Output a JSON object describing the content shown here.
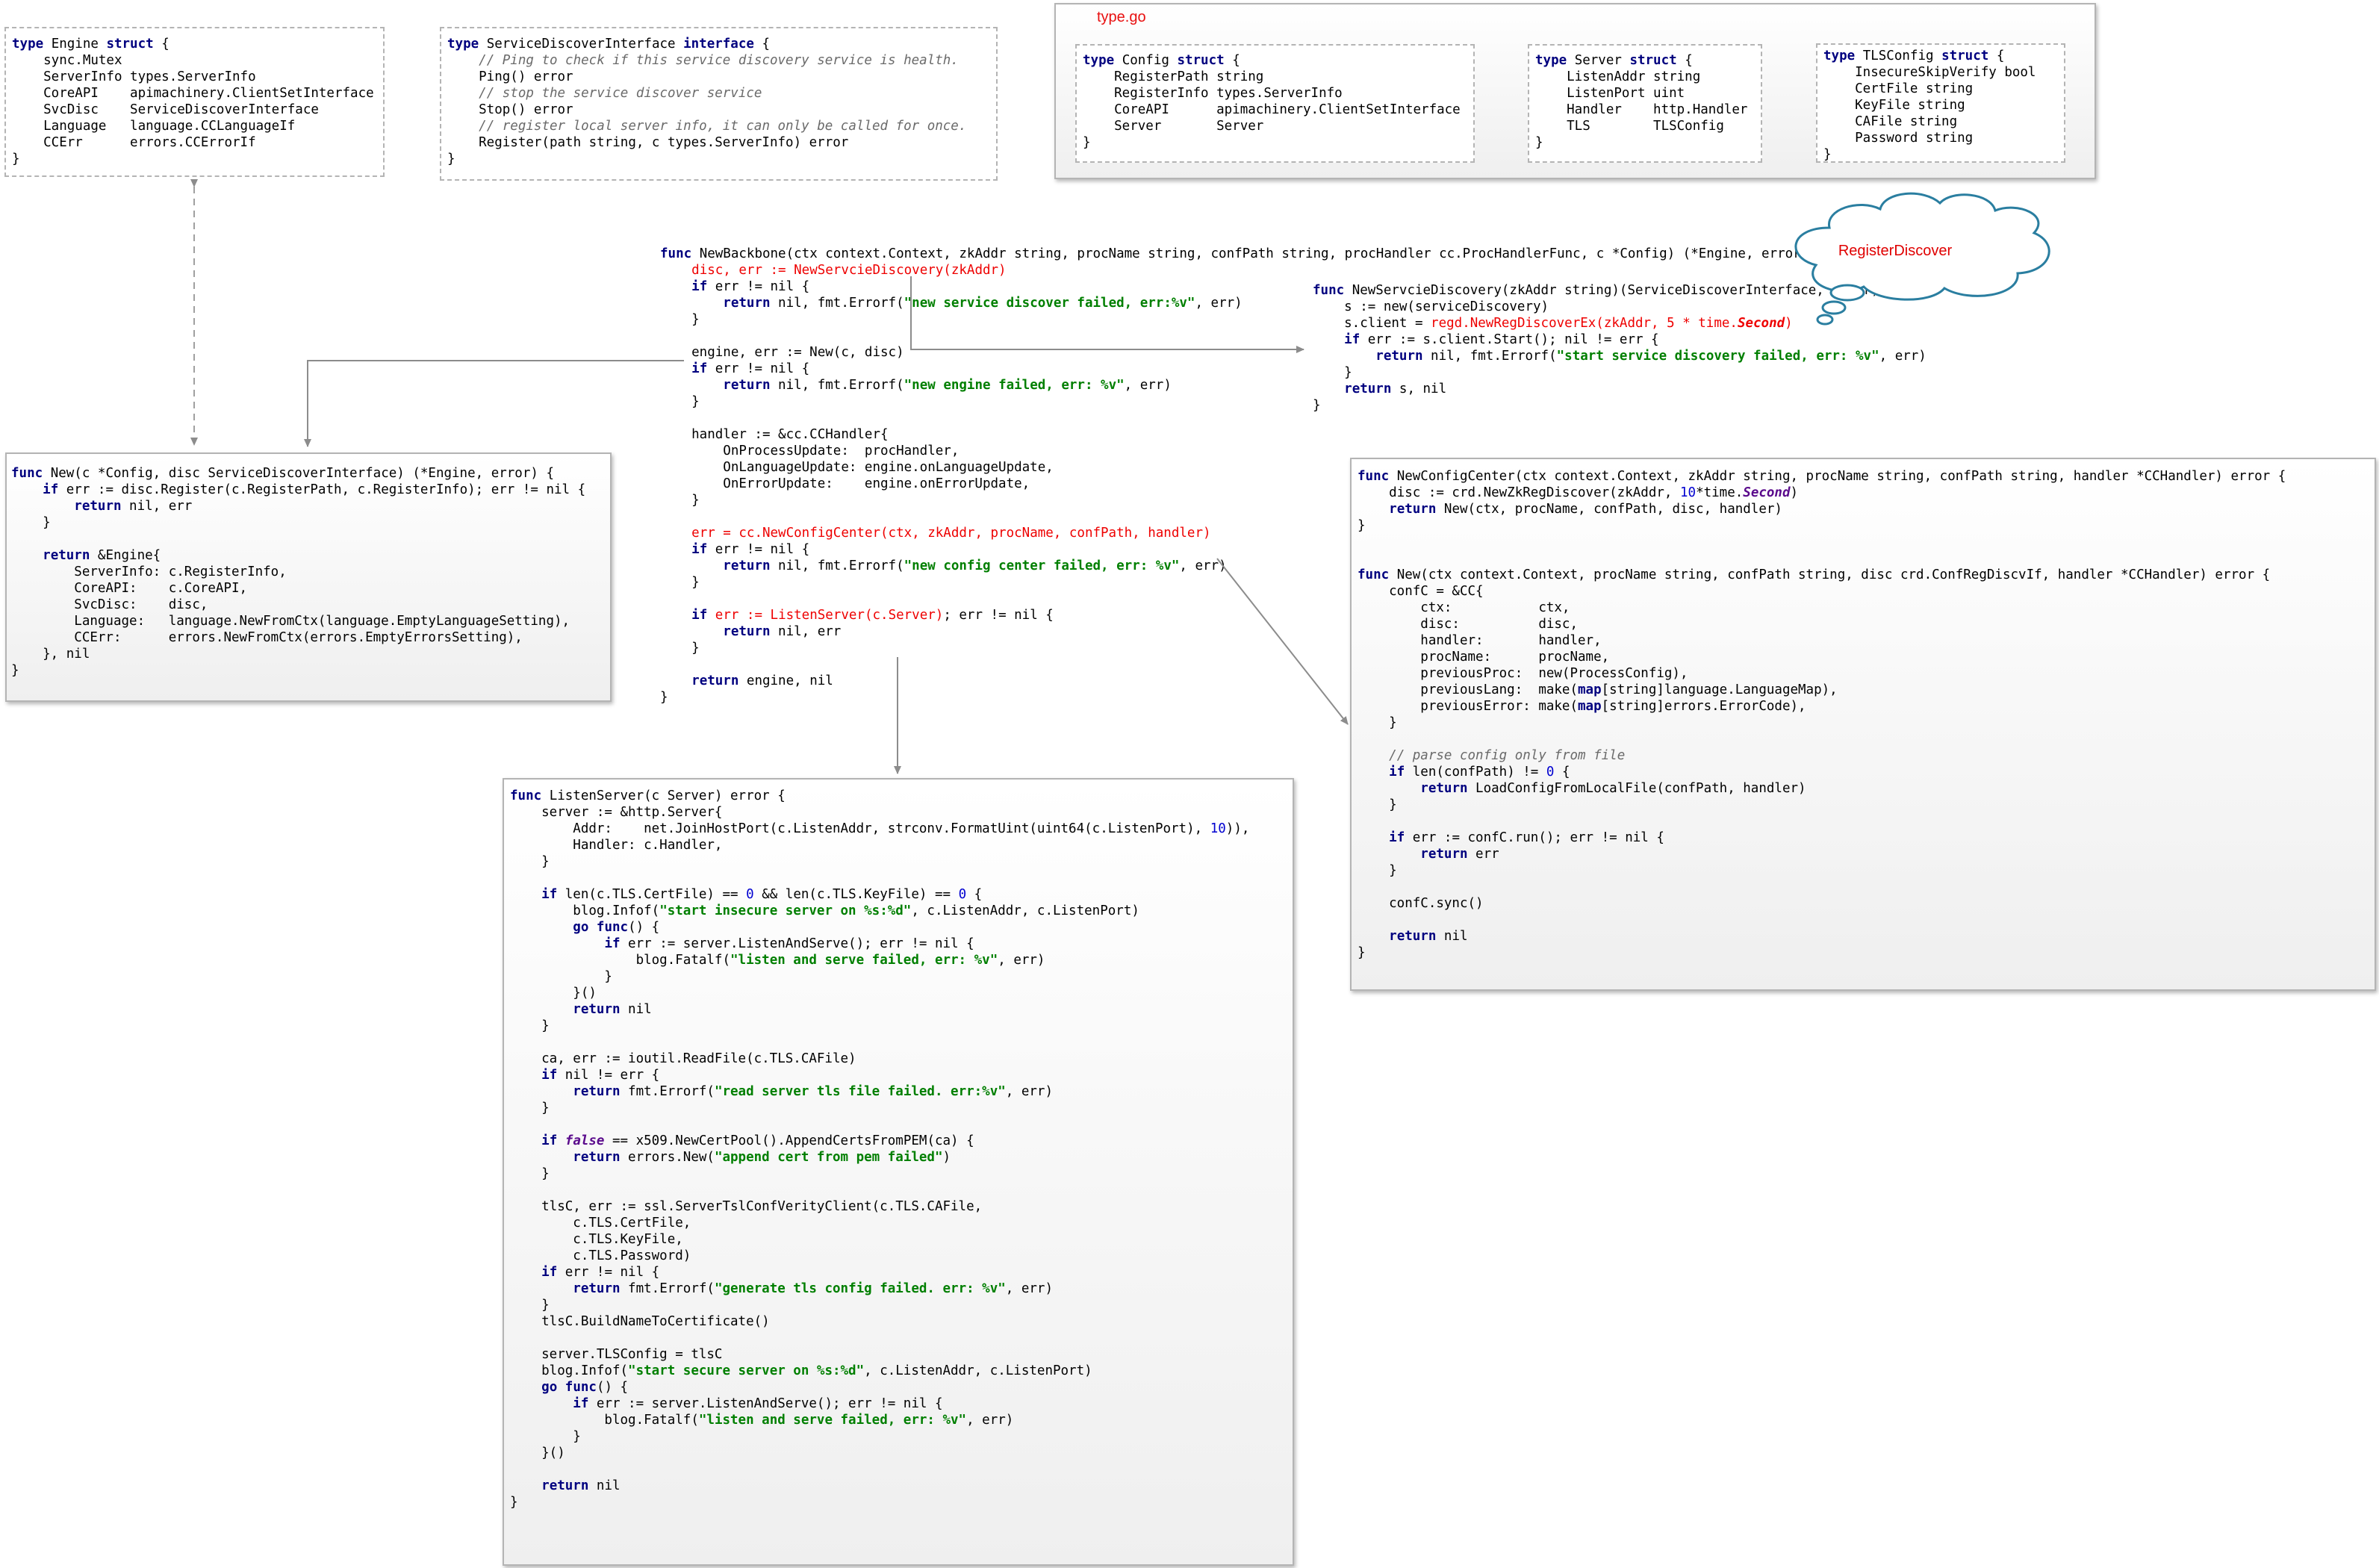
{
  "typego_title": "type.go",
  "cloud_label": "RegisterDiscover",
  "colors": {
    "keyword": "#00007f",
    "string": "#007f00",
    "number": "#0000d0",
    "comment": "#6a6a6a",
    "highlight": "#ee0000",
    "constant": "#5a0a8c",
    "cloud_stroke": "#2a7ea0",
    "box_border": "#b4b4b4",
    "arrow": "#8c8c8c"
  },
  "code": {
    "engine_struct": [
      "type Engine struct {",
      "    sync.Mutex",
      "    ServerInfo types.ServerInfo",
      "    CoreAPI    apimachinery.ClientSetInterface",
      "    SvcDisc    ServiceDiscoverInterface",
      "    Language   language.CCLanguageIf",
      "    CCErr      errors.CCErrorIf",
      "}"
    ],
    "service_discover_interface": [
      "type ServiceDiscoverInterface interface {",
      "    // Ping to check if this service discovery service is health.",
      "    Ping() error",
      "    // stop the service discover service",
      "    Stop() error",
      "    // register local server info, it can only be called for once.",
      "    Register(path string, c types.ServerInfo) error",
      "}"
    ],
    "config_struct": [
      "type Config struct {",
      "    RegisterPath string",
      "    RegisterInfo types.ServerInfo",
      "    CoreAPI      apimachinery.ClientSetInterface",
      "    Server       Server",
      "}"
    ],
    "server_struct": [
      "type Server struct {",
      "    ListenAddr string",
      "    ListenPort uint",
      "    Handler    http.Handler",
      "    TLS        TLSConfig",
      "}"
    ],
    "tlsconfig_struct": [
      "type TLSConfig struct {",
      "    InsecureSkipVerify bool",
      "    CertFile string",
      "    KeyFile string",
      "    CAFile string",
      "    Password string",
      "}"
    ],
    "new_backbone": [
      "func NewBackbone(ctx context.Context, zkAddr string, procName string, confPath string, procHandler cc.ProcHandlerFunc, c *Config) (*Engine, error) {",
      "    disc, err := NewServcieDiscovery(zkAddr)",
      "    if err != nil {",
      "        return nil, fmt.Errorf(\"new service discover failed, err:%v\", err)",
      "    }",
      "",
      "    engine, err := New(c, disc)",
      "    if err != nil {",
      "        return nil, fmt.Errorf(\"new engine failed, err: %v\", err)",
      "    }",
      "",
      "    handler := &cc.CCHandler{",
      "        OnProcessUpdate:  procHandler,",
      "        OnLanguageUpdate: engine.onLanguageUpdate,",
      "        OnErrorUpdate:    engine.onErrorUpdate,",
      "    }",
      "",
      "    err = cc.NewConfigCenter(ctx, zkAddr, procName, confPath, handler)",
      "    if err != nil {",
      "        return nil, fmt.Errorf(\"new config center failed, err: %v\", err)",
      "    }",
      "",
      "    if err := ListenServer(c.Server); err != nil {",
      "        return nil, err",
      "    }",
      "",
      "    return engine, nil",
      "}"
    ],
    "new_service_discovery": [
      "func NewServcieDiscovery(zkAddr string)(ServiceDiscoverInterface, error) {",
      "    s := new(serviceDiscovery)",
      "    s.client = regd.NewRegDiscoverEx(zkAddr, 5 * time.Second)",
      "    if err := s.client.Start(); nil != err {",
      "        return nil, fmt.Errorf(\"start service discovery failed, err: %v\", err)",
      "    }",
      "    return s, nil",
      "}"
    ],
    "new_engine": [
      "func New(c *Config, disc ServiceDiscoverInterface) (*Engine, error) {",
      "    if err := disc.Register(c.RegisterPath, c.RegisterInfo); err != nil {",
      "        return nil, err",
      "    }",
      "",
      "    return &Engine{",
      "        ServerInfo: c.RegisterInfo,",
      "        CoreAPI:    c.CoreAPI,",
      "        SvcDisc:    disc,",
      "        Language:   language.NewFromCtx(language.EmptyLanguageSetting),",
      "        CCErr:      errors.NewFromCtx(errors.EmptyErrorsSetting),",
      "    }, nil",
      "}"
    ],
    "new_config_center": [
      "func NewConfigCenter(ctx context.Context, zkAddr string, procName string, confPath string, handler *CCHandler) error {",
      "    disc := crd.NewZkRegDiscover(zkAddr, 10*time.Second)",
      "    return New(ctx, procName, confPath, disc, handler)",
      "}",
      "",
      "",
      "func New(ctx context.Context, procName string, confPath string, disc crd.ConfRegDiscvIf, handler *CCHandler) error {",
      "    confC = &CC{",
      "        ctx:           ctx,",
      "        disc:          disc,",
      "        handler:       handler,",
      "        procName:      procName,",
      "        previousProc:  new(ProcessConfig),",
      "        previousLang:  make(map[string]language.LanguageMap),",
      "        previousError: make(map[string]errors.ErrorCode),",
      "    }",
      "",
      "    // parse config only from file",
      "    if len(confPath) != 0 {",
      "        return LoadConfigFromLocalFile(confPath, handler)",
      "    }",
      "",
      "    if err := confC.run(); err != nil {",
      "        return err",
      "    }",
      "",
      "    confC.sync()",
      "",
      "    return nil",
      "}"
    ],
    "listen_server": [
      "func ListenServer(c Server) error {",
      "    server := &http.Server{",
      "        Addr:    net.JoinHostPort(c.ListenAddr, strconv.FormatUint(uint64(c.ListenPort), 10)),",
      "        Handler: c.Handler,",
      "    }",
      "",
      "    if len(c.TLS.CertFile) == 0 && len(c.TLS.KeyFile) == 0 {",
      "        blog.Infof(\"start insecure server on %s:%d\", c.ListenAddr, c.ListenPort)",
      "        go func() {",
      "            if err := server.ListenAndServe(); err != nil {",
      "                blog.Fatalf(\"listen and serve failed, err: %v\", err)",
      "            }",
      "        }()",
      "        return nil",
      "    }",
      "",
      "    ca, err := ioutil.ReadFile(c.TLS.CAFile)",
      "    if nil != err {",
      "        return fmt.Errorf(\"read server tls file failed. err:%v\", err)",
      "    }",
      "",
      "    if false == x509.NewCertPool().AppendCertsFromPEM(ca) {",
      "        return errors.New(\"append cert from pem failed\")",
      "    }",
      "",
      "    tlsC, err := ssl.ServerTslConfVerityClient(c.TLS.CAFile,",
      "        c.TLS.CertFile,",
      "        c.TLS.KeyFile,",
      "        c.TLS.Password)",
      "    if err != nil {",
      "        return fmt.Errorf(\"generate tls config failed. err: %v\", err)",
      "    }",
      "    tlsC.BuildNameToCertificate()",
      "",
      "    server.TLSConfig = tlsC",
      "    blog.Infof(\"start secure server on %s:%d\", c.ListenAddr, c.ListenPort)",
      "    go func() {",
      "        if err := server.ListenAndServe(); err != nil {",
      "            blog.Fatalf(\"listen and serve failed, err: %v\", err)",
      "        }",
      "    }()",
      "",
      "    return nil",
      "}"
    ]
  },
  "highlight_lines": {
    "new_backbone": [
      1,
      17,
      22
    ],
    "new_service_discovery": [
      2
    ]
  }
}
